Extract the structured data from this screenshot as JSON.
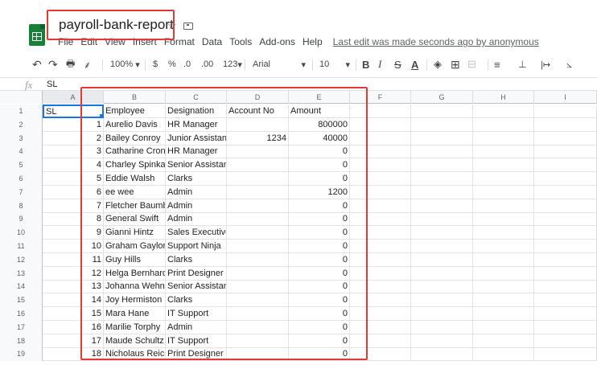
{
  "document": {
    "title": "payroll-bank-report",
    "star_icon": "star-outline-icon",
    "folder_icon": "move-to-folder-icon"
  },
  "menu": [
    "File",
    "Edit",
    "View",
    "Insert",
    "Format",
    "Data",
    "Tools",
    "Add-ons",
    "Help"
  ],
  "last_edit": "Last edit was made seconds ago by anonymous",
  "toolbar": {
    "undo": "↶",
    "redo": "↷",
    "print": "🖶",
    "paint_format": "⸙",
    "zoom": "100%",
    "currency": "$",
    "percent": "%",
    "decrease_decimal": ".0",
    "increase_decimal": ".00",
    "more_formats": "123",
    "font": "Arial",
    "font_size": "10",
    "bold": "B",
    "italic": "I",
    "strikethrough": "S",
    "text_color": "A",
    "fill_color": "◈",
    "borders": "⊞",
    "merge": "⊟",
    "align": "≡",
    "valign": "⊥",
    "wrap": "|↦",
    "rotate": "⦣"
  },
  "formula_bar": {
    "fx": "fx",
    "content": "SL"
  },
  "columns": [
    "A",
    "B",
    "C",
    "D",
    "E",
    "F",
    "G",
    "H",
    "I"
  ],
  "rows": [
    {
      "n": "1",
      "a": "SL",
      "b": "Employee",
      "c": "Designation",
      "d": "Account No",
      "e": "Amount"
    },
    {
      "n": "2",
      "a": "1",
      "b": "Aurelio Davis",
      "c": "HR Manager",
      "d": "",
      "e": "800000"
    },
    {
      "n": "3",
      "a": "2",
      "b": "Bailey Conroy",
      "c": "Junior Assistant P",
      "d": "1234",
      "e": "40000"
    },
    {
      "n": "4",
      "a": "3",
      "b": "Catharine Cronin",
      "c": "HR Manager",
      "d": "",
      "e": "0"
    },
    {
      "n": "5",
      "a": "4",
      "b": "Charley Spinka",
      "c": "Senior Assistant Professor",
      "d": "",
      "e": "0"
    },
    {
      "n": "6",
      "a": "5",
      "b": "Eddie Walsh",
      "c": "Clarks",
      "d": "",
      "e": "0"
    },
    {
      "n": "7",
      "a": "6",
      "b": "ee wee",
      "c": "Admin",
      "d": "",
      "e": "1200"
    },
    {
      "n": "8",
      "a": "7",
      "b": "Fletcher Baumbach",
      "c": "Admin",
      "d": "",
      "e": "0"
    },
    {
      "n": "9",
      "a": "8",
      "b": "General Swift",
      "c": "Admin",
      "d": "",
      "e": "0"
    },
    {
      "n": "10",
      "a": "9",
      "b": "Gianni Hintz",
      "c": "Sales Executive",
      "d": "",
      "e": "0"
    },
    {
      "n": "11",
      "a": "10",
      "b": "Graham Gaylord",
      "c": "Support Ninja",
      "d": "",
      "e": "0"
    },
    {
      "n": "12",
      "a": "11",
      "b": "Guy Hills",
      "c": "Clarks",
      "d": "",
      "e": "0"
    },
    {
      "n": "13",
      "a": "12",
      "b": "Helga Bernhard",
      "c": "Print Designer",
      "d": "",
      "e": "0"
    },
    {
      "n": "14",
      "a": "13",
      "b": "Johanna Wehner",
      "c": "Senior Assistant Professor",
      "d": "",
      "e": "0"
    },
    {
      "n": "15",
      "a": "14",
      "b": "Joy Hermiston",
      "c": "Clarks",
      "d": "",
      "e": "0"
    },
    {
      "n": "16",
      "a": "15",
      "b": "Mara Hane",
      "c": "IT Support",
      "d": "",
      "e": "0"
    },
    {
      "n": "17",
      "a": "16",
      "b": "Marilie Torphy",
      "c": "Admin",
      "d": "",
      "e": "0"
    },
    {
      "n": "18",
      "a": "17",
      "b": "Maude Schultz",
      "c": "IT Support",
      "d": "",
      "e": "0"
    },
    {
      "n": "19",
      "a": "18",
      "b": "Nicholaus Reichel",
      "c": "Print Designer",
      "d": "",
      "e": "0"
    }
  ],
  "colors": {
    "highlight": "#e53935",
    "selection": "#1a73e8",
    "sheets_green": "#188038"
  }
}
